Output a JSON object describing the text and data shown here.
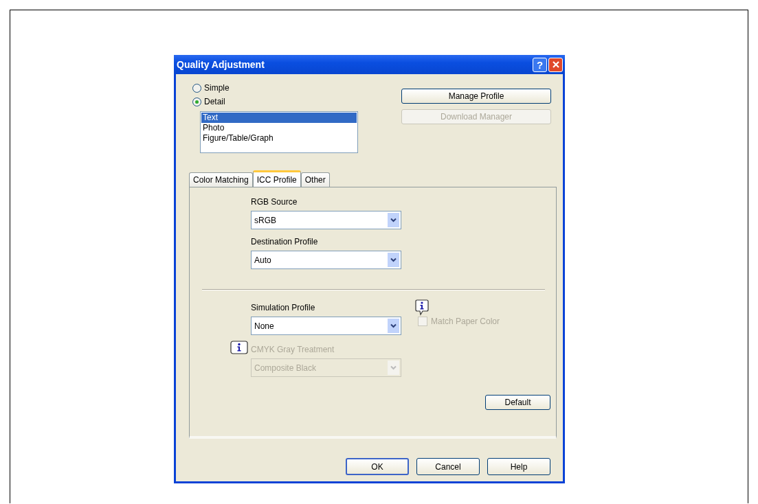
{
  "window": {
    "title": "Quality Adjustment",
    "help_button": "?"
  },
  "mode_options": [
    {
      "label": "Simple",
      "selected": false
    },
    {
      "label": "Detail",
      "selected": true
    }
  ],
  "object_list": [
    {
      "label": "Text",
      "selected": true
    },
    {
      "label": "Photo",
      "selected": false
    },
    {
      "label": "Figure/Table/Graph",
      "selected": false
    }
  ],
  "side_buttons": [
    {
      "label": "Manage Profile",
      "disabled": false
    },
    {
      "label": "Download Manager",
      "disabled": true
    }
  ],
  "tabs": [
    {
      "label": "Color Matching",
      "selected": false
    },
    {
      "label": "ICC Profile",
      "selected": true
    },
    {
      "label": "Other",
      "selected": false
    }
  ],
  "panel": {
    "rgb_source": {
      "label": "RGB Source",
      "value": "sRGB",
      "disabled": false
    },
    "destination_profile": {
      "label": "Destination Profile",
      "value": "Auto",
      "disabled": false
    },
    "simulation_profile": {
      "label": "Simulation Profile",
      "value": "None",
      "disabled": false
    },
    "match_paper_color": {
      "label": "Match Paper Color",
      "checked": false,
      "disabled": true
    },
    "cmyk_gray_treatment": {
      "label": "CMYK Gray Treatment",
      "value": "Composite Black",
      "disabled": true
    },
    "default_button": "Default"
  },
  "buttons": [
    "OK",
    "Cancel",
    "Help"
  ]
}
